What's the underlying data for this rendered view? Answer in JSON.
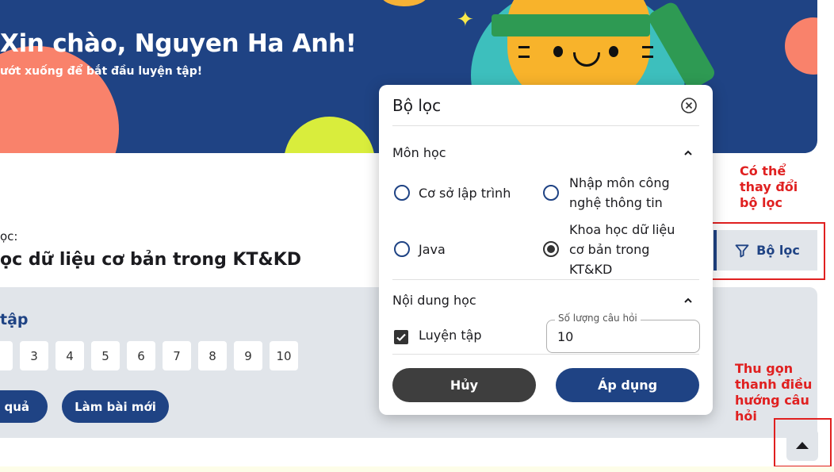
{
  "banner": {
    "greeting": "Xin chào, Nguyen Ha Anh!",
    "subtitle": "ướt xuống để bắt đầu luyện tập!"
  },
  "subject": {
    "label": "ọc:",
    "name": "ọc dữ liệu cơ bản trong KT&KD"
  },
  "practice": {
    "title": "tập",
    "numbers": [
      "",
      "3",
      "4",
      "5",
      "6",
      "7",
      "8",
      "9",
      "10"
    ],
    "result_button": "ết quả",
    "new_test_button": "Làm bài mới"
  },
  "side": {
    "filter_button": "Bộ lọc",
    "annotation_filter": "Có thể thay đổi bộ lọc",
    "annotation_collapse": "Thu gọn thanh điều hướng câu hỏi"
  },
  "filter_popup": {
    "title": "Bộ lọc",
    "subject_section": "Môn học",
    "options": [
      {
        "label": "Cơ sở lập trình",
        "checked": false
      },
      {
        "label": "Nhập môn công nghệ thông tin",
        "checked": false
      },
      {
        "label": "Java",
        "checked": false
      },
      {
        "label": "Khoa học dữ liệu cơ bản trong KT&KD",
        "checked": true
      }
    ],
    "content_section": "Nội dung học",
    "practice_checkbox": "Luyện tập",
    "quantity_label": "Số lượng câu hỏi",
    "quantity_value": "10",
    "cancel_button": "Hủy",
    "apply_button": "Áp dụng"
  },
  "colors": {
    "primary": "#1f4384",
    "annotation": "#e02020",
    "panel": "#e1e5ea"
  },
  "icons": [
    "close-icon",
    "chevron-up-icon",
    "filter-icon",
    "caret-up-icon",
    "check-icon"
  ]
}
